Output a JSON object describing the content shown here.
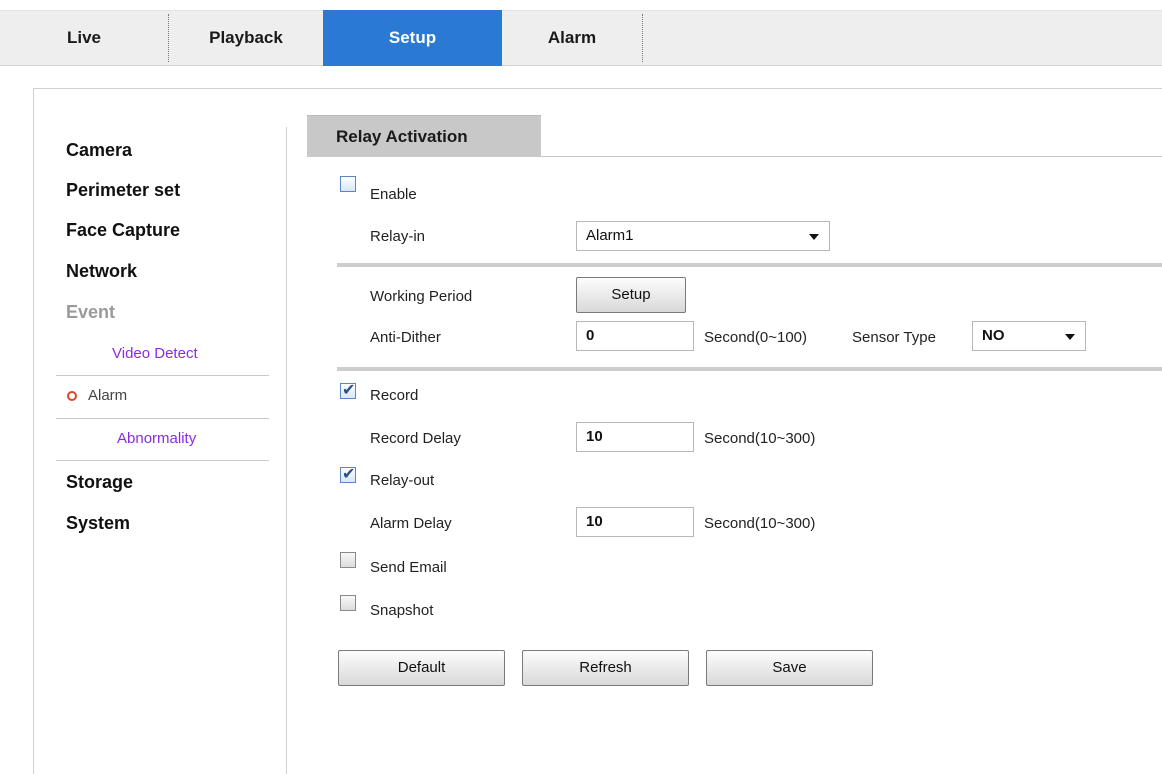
{
  "nav": {
    "tabs": [
      {
        "label": "Live"
      },
      {
        "label": "Playback"
      },
      {
        "label": "Setup"
      },
      {
        "label": "Alarm"
      }
    ],
    "active_color": "#2a7ad3"
  },
  "sidebar": {
    "items": [
      {
        "label": "Camera"
      },
      {
        "label": "Perimeter set"
      },
      {
        "label": "Face Capture"
      },
      {
        "label": "Network"
      },
      {
        "label": "Event"
      },
      {
        "label": "Storage"
      },
      {
        "label": "System"
      }
    ],
    "event_sub": [
      {
        "label": "Video Detect"
      },
      {
        "label": "Alarm"
      },
      {
        "label": "Abnormality"
      }
    ]
  },
  "panel": {
    "title": "Relay Activation",
    "enable": {
      "label": "Enable",
      "checked": false
    },
    "relay_in": {
      "label": "Relay-in",
      "value": "Alarm1"
    },
    "working_period": {
      "label": "Working Period",
      "button": "Setup"
    },
    "anti_dither": {
      "label": "Anti-Dither",
      "value": "0",
      "unit": "Second(0~100)"
    },
    "sensor_type": {
      "label": "Sensor Type",
      "value": "NO"
    },
    "record": {
      "label": "Record",
      "checked": true
    },
    "record_delay": {
      "label": "Record Delay",
      "value": "10",
      "unit": "Second(10~300)"
    },
    "relay_out": {
      "label": "Relay-out",
      "checked": true
    },
    "alarm_delay": {
      "label": "Alarm Delay",
      "value": "10",
      "unit": "Second(10~300)"
    },
    "send_email": {
      "label": "Send Email",
      "checked": false
    },
    "snapshot": {
      "label": "Snapshot",
      "checked": false
    },
    "buttons": {
      "default": "Default",
      "refresh": "Refresh",
      "save": "Save"
    },
    "check_mark": "✔"
  }
}
